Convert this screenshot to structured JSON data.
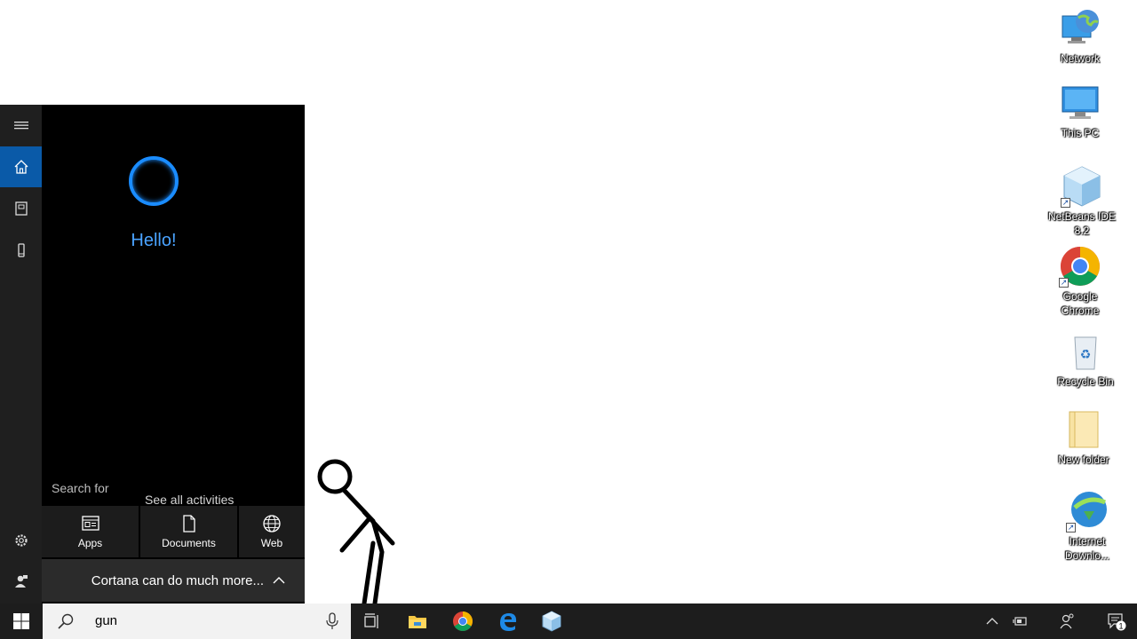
{
  "desktop": {
    "icons": [
      {
        "label": "Network",
        "icon": "network-icon"
      },
      {
        "label": "This PC",
        "icon": "computer-icon"
      },
      {
        "label": "NetBeans IDE 8.2",
        "icon": "netbeans-cube-icon",
        "shortcut": true
      },
      {
        "label": "Google Chrome",
        "icon": "chrome-icon",
        "shortcut": true
      },
      {
        "label": "Recycle Bin",
        "icon": "recycle-bin-icon"
      },
      {
        "label": "New folder",
        "icon": "folder-icon"
      },
      {
        "label": "Internet Downlo...",
        "icon": "internet-download-manager-icon",
        "shortcut": true
      }
    ]
  },
  "cortana": {
    "greeting": "Hello!",
    "search_for_label": "Search for",
    "see_all_label": "See all activities",
    "filters": [
      {
        "label": "Apps",
        "icon": "apps-icon"
      },
      {
        "label": "Documents",
        "icon": "document-icon"
      },
      {
        "label": "Web",
        "icon": "globe-icon"
      }
    ],
    "more_label": "Cortana can do much more...",
    "rail": [
      "hamburger-icon",
      "home-icon",
      "notebook-icon",
      "devices-icon",
      "settings-icon",
      "feedback-icon"
    ],
    "accent": "#1a8cff"
  },
  "taskbar": {
    "search_query": "gun",
    "apps": [
      "task-view-icon",
      "file-explorer-icon",
      "chrome-icon",
      "edge-icon",
      "netbeans-cube-icon"
    ],
    "tray": [
      "chevron-up-icon",
      "battery-icon",
      "people-icon",
      "action-center-icon"
    ],
    "notification_count": "1"
  }
}
